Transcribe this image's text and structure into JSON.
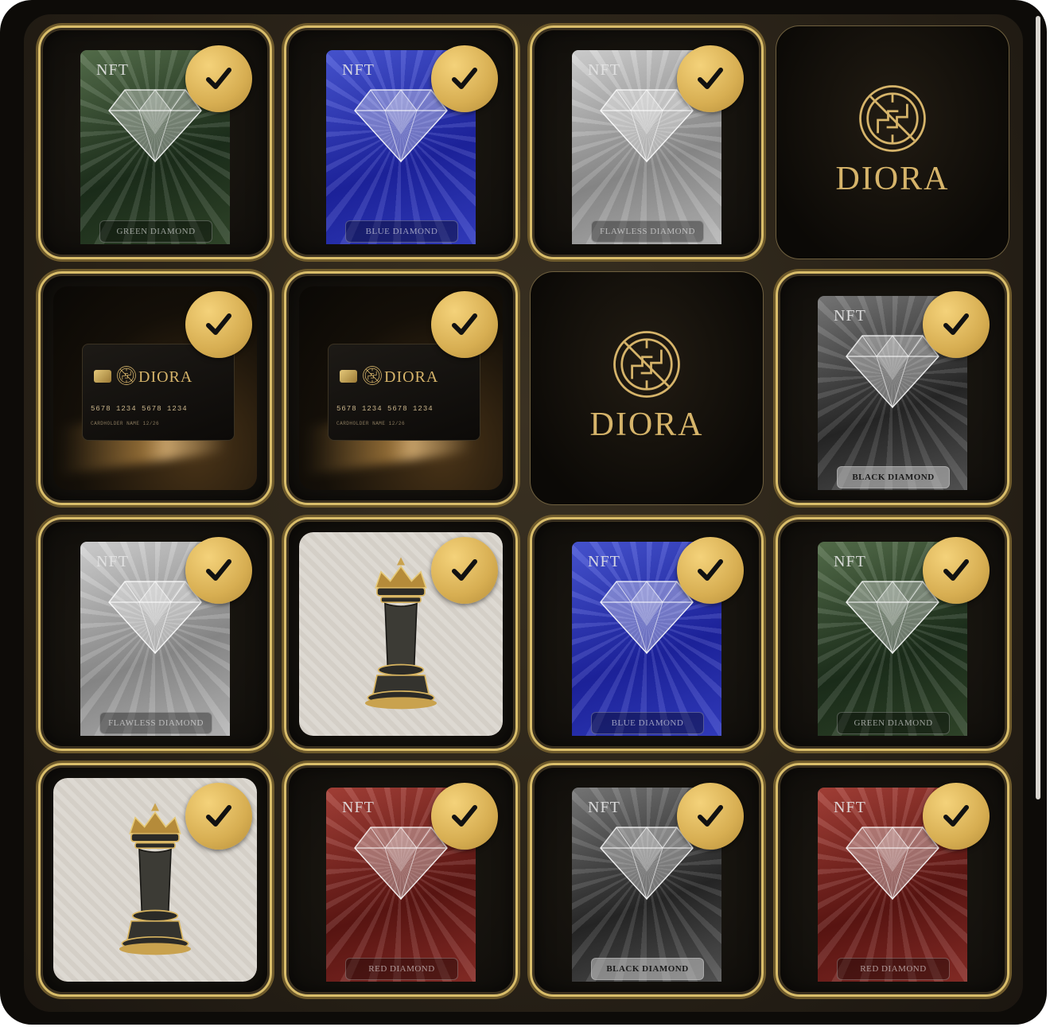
{
  "brand": "DIORA",
  "colors": {
    "gold": "#d6b46a",
    "selected_border": "#d9bd6a",
    "check_badge": "#e2bb5f"
  },
  "grid": {
    "rows": [
      [
        {
          "kind": "nft",
          "variant": "green",
          "tag": "NFT",
          "label": "GREEN DIAMOND",
          "selected": true
        },
        {
          "kind": "nft",
          "variant": "blue",
          "tag": "NFT",
          "label": "BLUE DIAMOND",
          "selected": true
        },
        {
          "kind": "nft",
          "variant": "flawless",
          "tag": "NFT",
          "label": "FLAWLESS DIAMOND",
          "selected": true
        },
        {
          "kind": "logo",
          "text": "DIORA",
          "selected": false
        }
      ],
      [
        {
          "kind": "card",
          "brand": "DIORA",
          "number": "5678 1234 5678 1234",
          "holder": "CARDHOLDER NAME",
          "expiry": "12/26",
          "selected": true
        },
        {
          "kind": "card",
          "brand": "DIORA",
          "number": "5678 1234 5678 1234",
          "holder": "CARDHOLDER NAME",
          "expiry": "12/26",
          "selected": true
        },
        {
          "kind": "logo",
          "text": "DIORA",
          "selected": false
        },
        {
          "kind": "nft",
          "variant": "black",
          "tag": "NFT",
          "label": "BLACK DIAMOND",
          "selected": true
        }
      ],
      [
        {
          "kind": "nft",
          "variant": "flawless",
          "tag": "NFT",
          "label": "FLAWLESS DIAMOND",
          "selected": true
        },
        {
          "kind": "chess",
          "piece": "queen-icon",
          "selected": true
        },
        {
          "kind": "nft",
          "variant": "blue",
          "tag": "NFT",
          "label": "BLUE DIAMOND",
          "selected": true
        },
        {
          "kind": "nft",
          "variant": "green",
          "tag": "NFT",
          "label": "GREEN DIAMOND",
          "selected": true
        }
      ],
      [
        {
          "kind": "chess",
          "piece": "queen-icon",
          "selected": true
        },
        {
          "kind": "nft",
          "variant": "red",
          "tag": "NFT",
          "label": "RED DIAMOND",
          "selected": true
        },
        {
          "kind": "nft",
          "variant": "black",
          "tag": "NFT",
          "label": "BLACK DIAMOND",
          "selected": true
        },
        {
          "kind": "nft",
          "variant": "red",
          "tag": "NFT",
          "label": "RED DIAMOND",
          "selected": true
        }
      ]
    ]
  }
}
